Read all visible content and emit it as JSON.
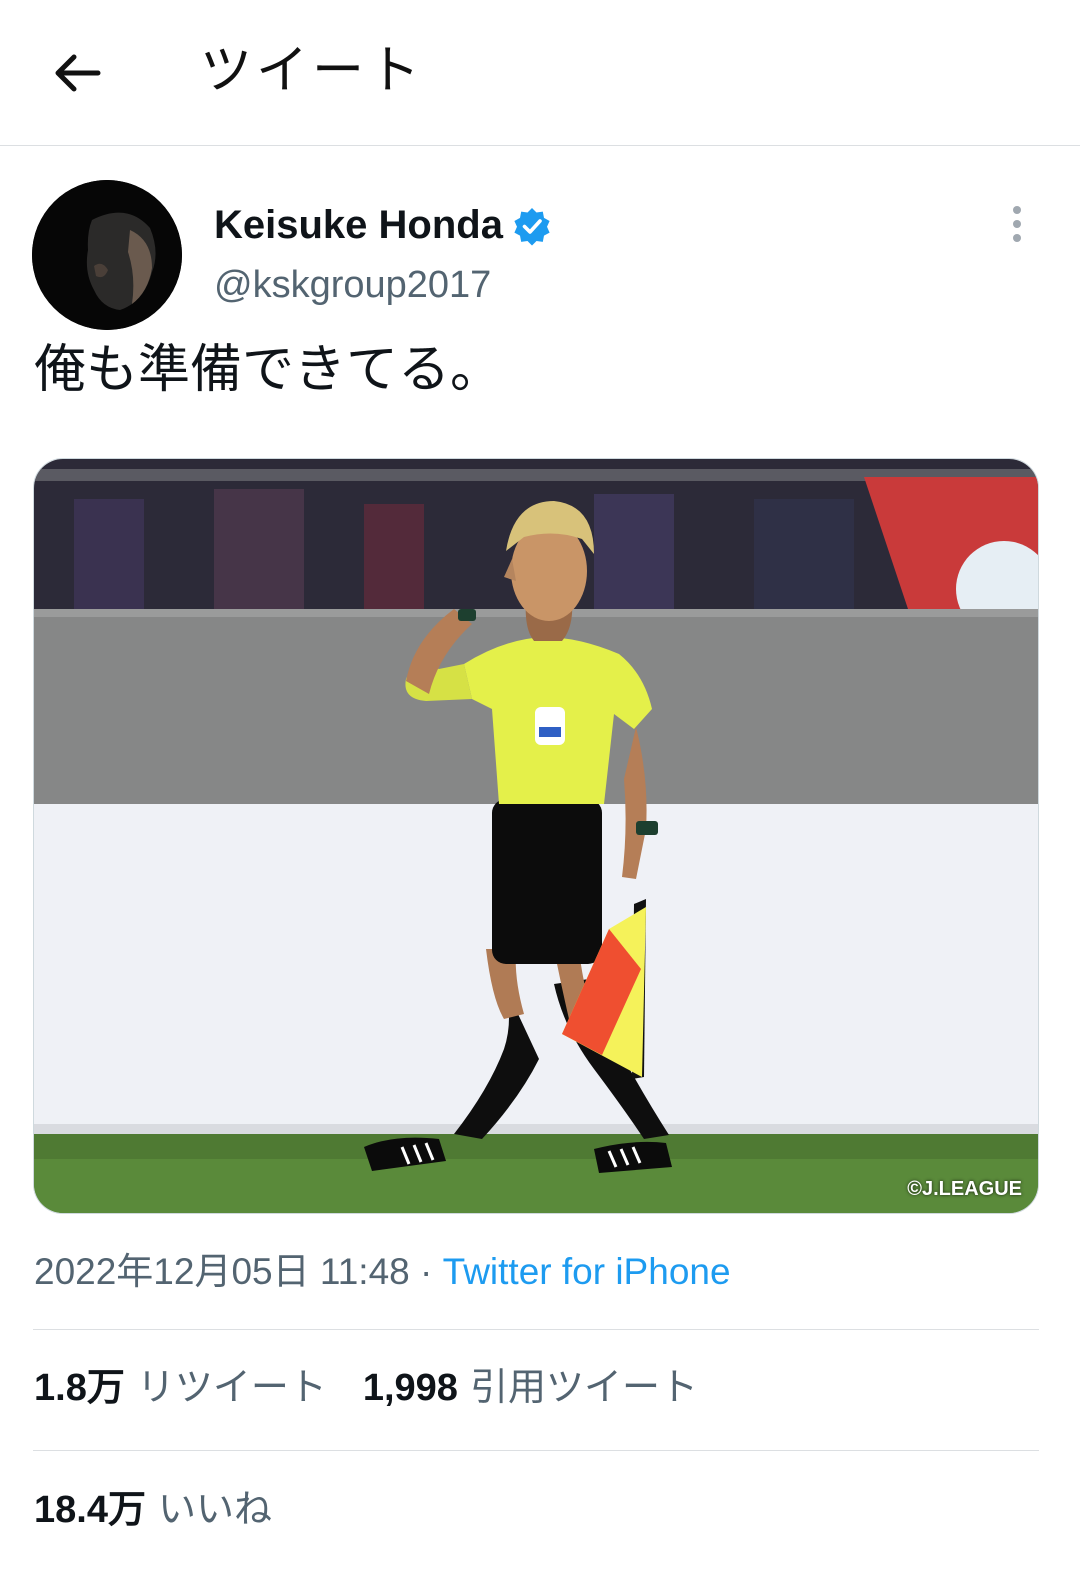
{
  "header": {
    "title": "ツイート",
    "back_icon": "arrow-left-icon"
  },
  "author": {
    "display_name": "Keisuke Honda",
    "handle": "@kskgroup2017",
    "verified_color": "#1d9bf0",
    "avatar_icon": "profile-photo"
  },
  "tweet": {
    "text": "俺も準備できてる。",
    "media_watermark": "©J.LEAGUE",
    "timestamp": "2022年12月05日 11:48",
    "separator": "·",
    "source": "Twitter for iPhone"
  },
  "stats": {
    "retweets_count": "1.8万",
    "retweets_label": "リツイート",
    "quotes_count": "1,998",
    "quotes_label": "引用ツイート",
    "likes_count": "18.4万",
    "likes_label": "いいね"
  },
  "colors": {
    "accent": "#1d9bf0",
    "secondary_text": "#536471",
    "divider": "#dcdfe2"
  }
}
